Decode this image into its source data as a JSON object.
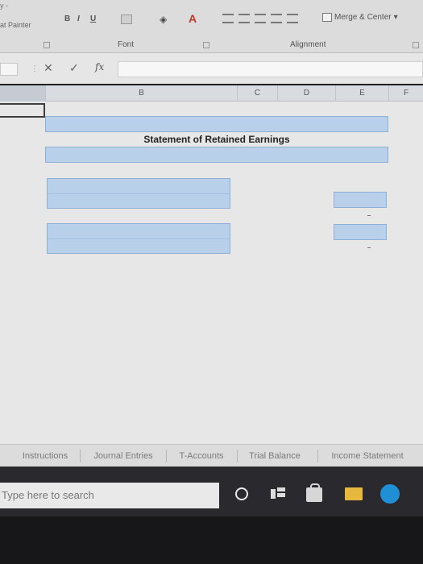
{
  "ribbon": {
    "format_painter": "at Painter",
    "clipboard_tail": "y -",
    "bold": "B",
    "italic": "I",
    "underline": "U",
    "merge_center": "Merge & Center",
    "groups": {
      "font": "Font",
      "alignment": "Alignment"
    }
  },
  "formula_bar": {
    "cancel_glyph": "✕",
    "enter_glyph": "✓",
    "fx": "fx",
    "value": ""
  },
  "columns": [
    "B",
    "C",
    "D",
    "E",
    "F"
  ],
  "sheet": {
    "title": "Statement of Retained Earnings"
  },
  "tabs": [
    "Instructions",
    "Journal Entries",
    "T-Accounts",
    "Trial Balance",
    "Income Statement"
  ],
  "taskbar": {
    "search_placeholder": "Type here to search"
  },
  "colors": {
    "cell_blue": "#b8d0ea",
    "grid_bg": "#e7e7e8",
    "taskbar": "#2a2a2e"
  }
}
